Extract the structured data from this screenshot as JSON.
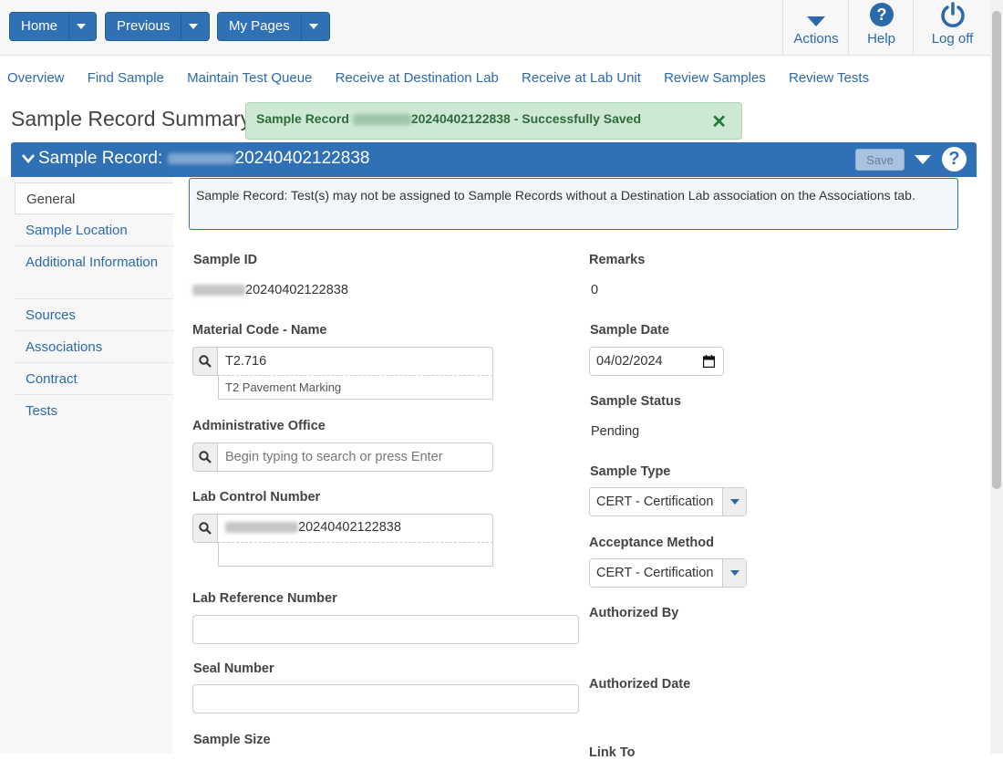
{
  "nav": {
    "home": "Home",
    "previous": "Previous",
    "my_pages": "My Pages"
  },
  "tools": {
    "actions": "Actions",
    "help": "Help",
    "logoff": "Log off"
  },
  "tabs": [
    "Overview",
    "Find Sample",
    "Maintain Test Queue",
    "Receive at Destination Lab",
    "Receive at Lab Unit",
    "Review Samples",
    "Review Tests"
  ],
  "page_title": "Sample Record Summary",
  "toast": {
    "prefix": "Sample Record ",
    "id": "20240402122838",
    "suffix": " - Successfully Saved",
    "close": "✕"
  },
  "panel": {
    "title": "Sample Record: ",
    "id": "20240402122838",
    "save": "Save",
    "help": "?"
  },
  "sidebar": [
    "General",
    "Sample Location",
    "Additional Information",
    "Sources",
    "Associations",
    "Contract",
    "Tests"
  ],
  "info_message": "Sample Record: Test(s) may not be assigned to Sample Records without a Destination Lab association on the Associations tab.",
  "form": {
    "sample_id": {
      "label": "Sample ID",
      "value": "20240402122838"
    },
    "material": {
      "label": "Material Code - Name",
      "value": "T2.716",
      "sub": "T2 Pavement Marking"
    },
    "admin_office": {
      "label": "Administrative Office",
      "placeholder": "Begin typing to search or press Enter"
    },
    "lab_control": {
      "label": "Lab Control Number",
      "value": "20240402122838"
    },
    "lab_ref": {
      "label": "Lab Reference Number",
      "value": ""
    },
    "seal": {
      "label": "Seal Number",
      "value": ""
    },
    "sample_size": {
      "label": "Sample Size"
    },
    "remarks": {
      "label": "Remarks",
      "value": "0"
    },
    "sample_date": {
      "label": "Sample Date",
      "value": "04/02/2024"
    },
    "sample_status": {
      "label": "Sample Status",
      "value": "Pending"
    },
    "sample_type": {
      "label": "Sample Type",
      "value": "CERT - Certification"
    },
    "acceptance": {
      "label": "Acceptance Method",
      "value": "CERT - Certification"
    },
    "authorized_by": {
      "label": "Authorized By"
    },
    "authorized_date": {
      "label": "Authorized Date"
    },
    "link_to": {
      "label": "Link To"
    }
  },
  "colors": {
    "primary": "#3071b5",
    "link": "#2a6aab",
    "success_bg": "#cde9d3"
  }
}
